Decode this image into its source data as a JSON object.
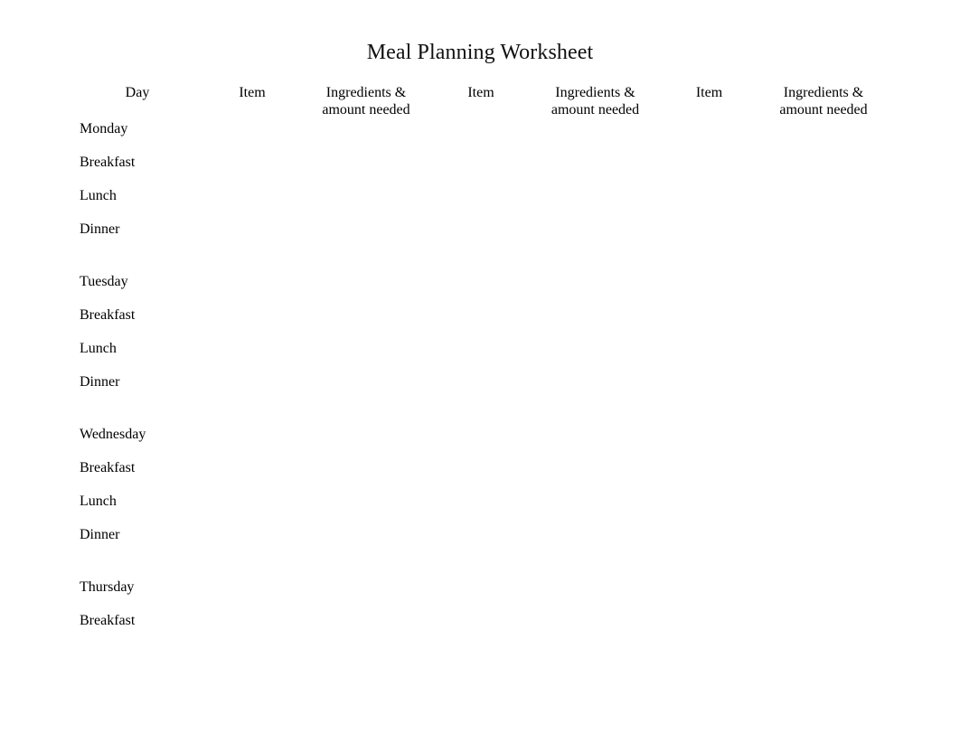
{
  "document": {
    "title": "Meal Planning Worksheet"
  },
  "table": {
    "headers": [
      "Day",
      "Item",
      "Ingredients &\namount needed",
      "Item",
      "Ingredients &\namount needed",
      "Item",
      "Ingredients &\namount needed"
    ],
    "meal_labels": {
      "breakfast": "Breakfast",
      "lunch": "Lunch",
      "dinner": "Dinner"
    },
    "days": [
      {
        "name": "Monday",
        "meals": [
          {
            "label": "Breakfast",
            "item1": "",
            "ingredients1": "",
            "item2": "",
            "ingredients2": "",
            "item3": "",
            "ingredients3": ""
          },
          {
            "label": "Lunch",
            "item1": "",
            "ingredients1": "",
            "item2": "",
            "ingredients2": "",
            "item3": "",
            "ingredients3": ""
          },
          {
            "label": "Dinner",
            "item1": "",
            "ingredients1": "",
            "item2": "",
            "ingredients2": "",
            "item3": "",
            "ingredients3": ""
          }
        ]
      },
      {
        "name": "Tuesday",
        "meals": [
          {
            "label": "Breakfast",
            "item1": "",
            "ingredients1": "",
            "item2": "",
            "ingredients2": "",
            "item3": "",
            "ingredients3": ""
          },
          {
            "label": "Lunch",
            "item1": "",
            "ingredients1": "",
            "item2": "",
            "ingredients2": "",
            "item3": "",
            "ingredients3": ""
          },
          {
            "label": "Dinner",
            "item1": "",
            "ingredients1": "",
            "item2": "",
            "ingredients2": "",
            "item3": "",
            "ingredients3": ""
          }
        ]
      },
      {
        "name": "Wednesday",
        "meals": [
          {
            "label": "Breakfast",
            "item1": "",
            "ingredients1": "",
            "item2": "",
            "ingredients2": "",
            "item3": "",
            "ingredients3": ""
          },
          {
            "label": "Lunch",
            "item1": "",
            "ingredients1": "",
            "item2": "",
            "ingredients2": "",
            "item3": "",
            "ingredients3": ""
          },
          {
            "label": "Dinner",
            "item1": "",
            "ingredients1": "",
            "item2": "",
            "ingredients2": "",
            "item3": "",
            "ingredients3": ""
          }
        ]
      },
      {
        "name": "Thursday",
        "meals": [
          {
            "label": "Breakfast",
            "item1": "",
            "ingredients1": "",
            "item2": "",
            "ingredients2": "",
            "item3": "",
            "ingredients3": ""
          }
        ]
      }
    ]
  },
  "style": {
    "text_color": "#111111",
    "background_color": "#ffffff"
  }
}
